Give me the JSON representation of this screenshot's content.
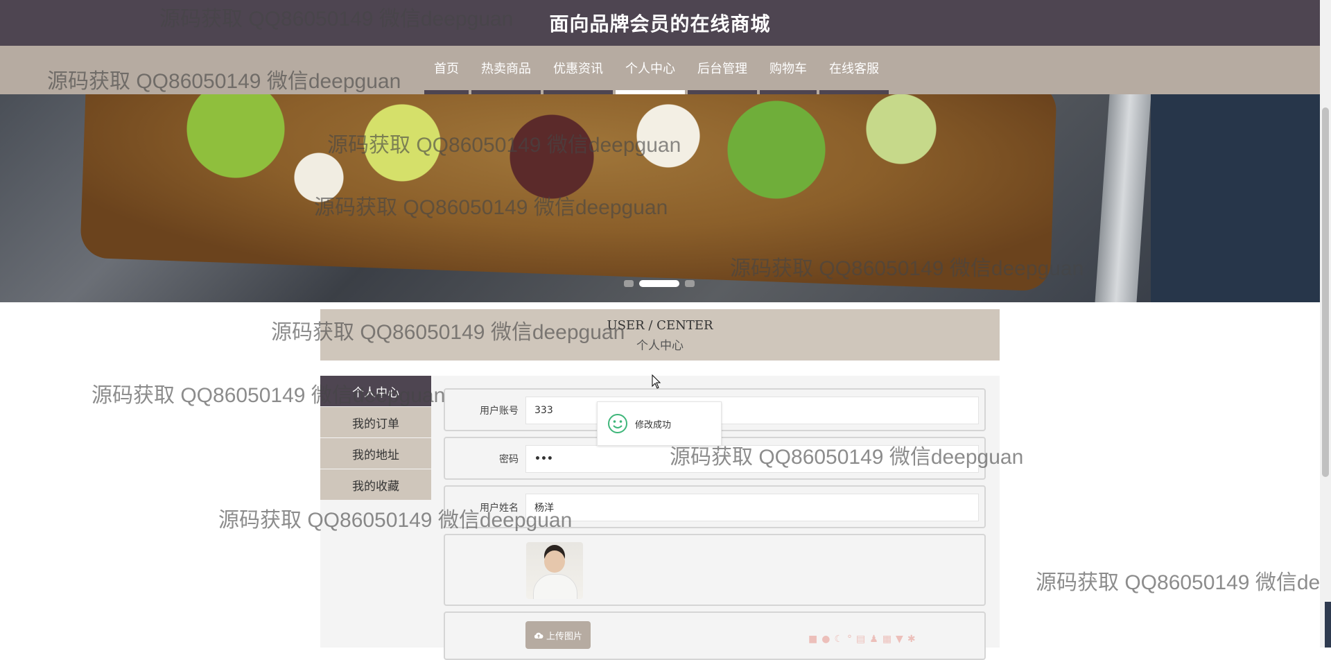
{
  "site": {
    "title": "面向品牌会员的在线商城"
  },
  "nav": {
    "items": [
      {
        "label": "首页",
        "active": false
      },
      {
        "label": "热卖商品",
        "active": false
      },
      {
        "label": "优惠资讯",
        "active": false
      },
      {
        "label": "个人中心",
        "active": true
      },
      {
        "label": "后台管理",
        "active": false
      },
      {
        "label": "购物车",
        "active": false
      },
      {
        "label": "在线客服",
        "active": false
      }
    ]
  },
  "banner": {
    "active_slide": 2,
    "slide_count": 3
  },
  "user_center": {
    "title_en": "USER / CENTER",
    "title_cn": "个人中心",
    "menu": [
      {
        "label": "个人中心",
        "active": true
      },
      {
        "label": "我的订单",
        "active": false
      },
      {
        "label": "我的地址",
        "active": false
      },
      {
        "label": "我的收藏",
        "active": false
      }
    ],
    "form": {
      "account_label": "用户账号",
      "account_value": "333",
      "password_label": "密码",
      "password_value": "•••",
      "name_label": "用户姓名",
      "name_value": "杨洋",
      "upload_label": "上传图片"
    }
  },
  "toast": {
    "message": "修改成功"
  },
  "watermark": {
    "text": "源码获取 QQ86050149 微信deepguan"
  },
  "colors": {
    "primary": "#4e4551",
    "secondary": "#b6aba1",
    "header_bg": "#cfc6bb",
    "toast_icon": "#3fb67a"
  }
}
